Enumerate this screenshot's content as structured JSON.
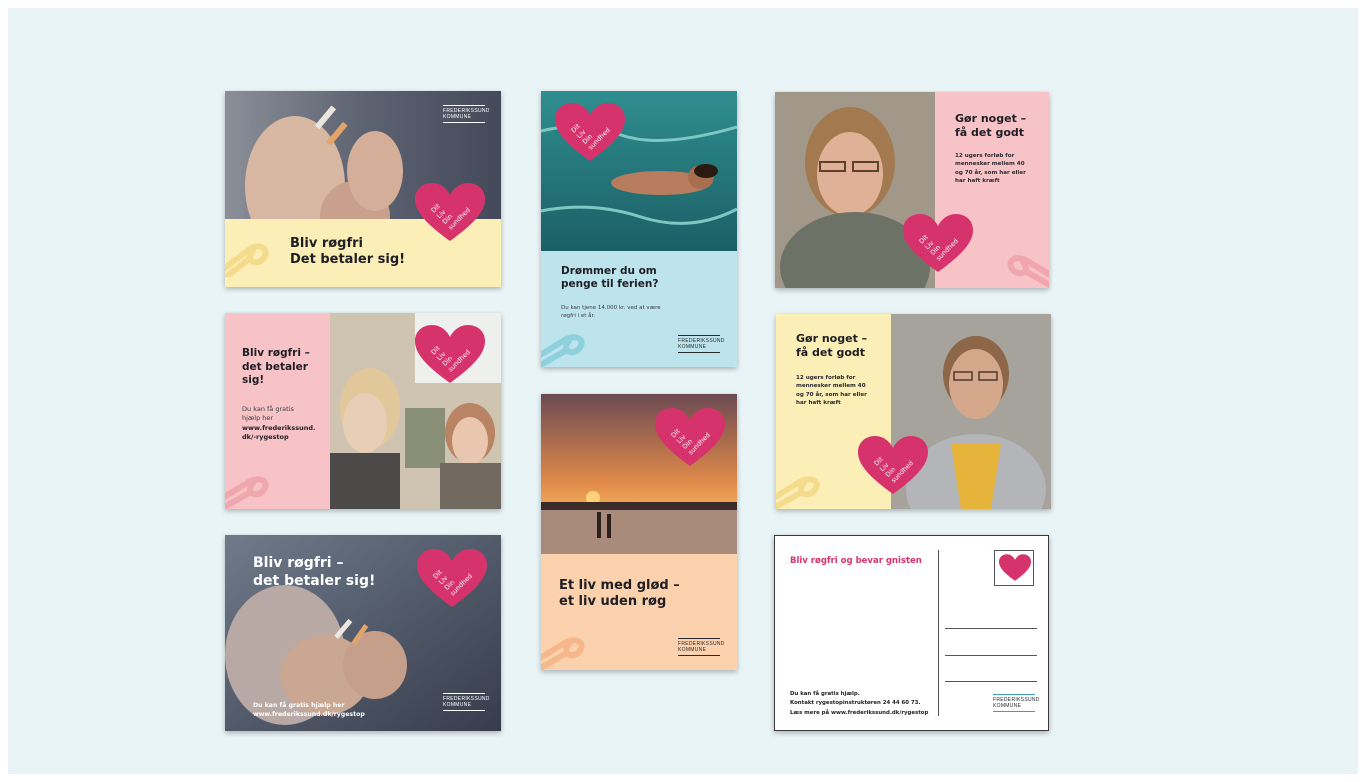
{
  "colors": {
    "pink_heart": "#d6336c",
    "yellow_panel": "#fbeeb7",
    "pink_panel": "#f7c3c7",
    "blue_panel": "#bde4ec",
    "peach_panel": "#fbd2ad",
    "background": "#e9f4f7"
  },
  "heart": {
    "line1": "Dit",
    "line2": "Liv",
    "line3": "Din",
    "line4": "sundhed"
  },
  "logo": {
    "line1": "FREDERIKSSUND",
    "line2": "KOMMUNE"
  },
  "card1": {
    "title1": "Bliv røgfri",
    "title2": "Det betaler sig!"
  },
  "card2": {
    "title1": "Bliv røgfri –",
    "title2": "det betaler",
    "title3": "sig!",
    "body1": "Du kan få gratis",
    "body2": "hjælp her",
    "link1": "www.frederikssund.",
    "link2": "dk/-rygestop"
  },
  "card3": {
    "title1": "Bliv røgfri –",
    "title2": "det betaler sig!",
    "foot1": "Du kan få gratis hjælp her",
    "foot2": "www.frederikssund.dk/rygestop"
  },
  "card4": {
    "title1": "Drømmer du om",
    "title2": "penge til ferien?",
    "body1": "Du kan tjene 14.000 kr. ved at være",
    "body2": "røgfri i et år."
  },
  "card5": {
    "title1": "Et liv med glød –",
    "title2": "et liv uden røg"
  },
  "card6": {
    "title1": "Gør noget –",
    "title2": "få det godt",
    "body1": "12 ugers forløb for",
    "body2": "mennesker mellem 40",
    "body3": "og 70 år, som har eller",
    "body4": "har haft kræft"
  },
  "card7": {
    "title1": "Gør noget –",
    "title2": "få det godt",
    "body1": "12 ugers forløb for",
    "body2": "mennesker mellem 40",
    "body3": "og 70 år, som har eller",
    "body4": "har haft kræft"
  },
  "card8": {
    "title": "Bliv røgfri og bevar gnisten",
    "foot1": "Du kan få gratis hjælp.",
    "foot2": "Kontakt rygestopinstruktøren 24 44 60 73.",
    "foot3": "Læs mere på www.frederikssund.dk/rygestop"
  }
}
